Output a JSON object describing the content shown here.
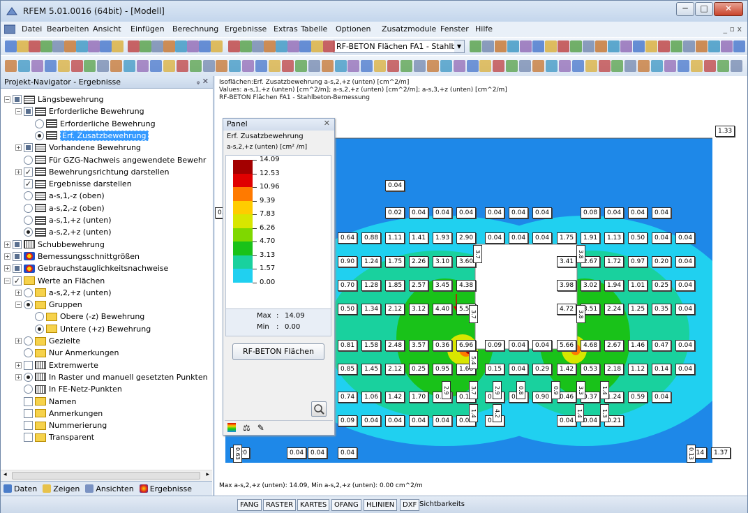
{
  "window": {
    "title": "RFEM 5.01.0016 (64bit) - [Modell]",
    "minimize": "─",
    "maximize": "□",
    "close": "✕"
  },
  "menu": [
    "Datei",
    "Bearbeiten",
    "Ansicht",
    "Einfügen",
    "Berechnung",
    "Ergebnisse",
    "Extras",
    "Tabelle",
    "Optionen",
    "Zusatzmodule",
    "Fenster",
    "Hilfe"
  ],
  "menu_sys": "_ ▫ x",
  "toolbar": {
    "combo_value": "RF-BETON Flächen FA1 - Stahlbeton-B"
  },
  "navigator": {
    "title": "Projekt-Navigator - Ergebnisse",
    "controls": "ᵩ ✕",
    "items": [
      "Längsbewehrung",
      "Erforderliche Bewehrung",
      "Erforderliche Bewehrung",
      "Erf. Zusatzbewehrung",
      "Vorhandene Bewehrung",
      "Für GZG-Nachweis angewendete Bewehr",
      "Bewehrungsrichtung darstellen",
      "Ergebnisse darstellen",
      "a-s,1,-z (oben)",
      "a-s,2,-z (oben)",
      "a-s,1,+z (unten)",
      "a-s,2,+z (unten)",
      "Schubbewehrung",
      "Bemessungsschnittgrößen",
      "Gebrauchstauglichkeitsnachweise",
      "Werte an Flächen",
      "a-s,2,+z (unten)",
      "Gruppen",
      "Obere (-z) Bewehrung",
      "Untere (+z) Bewehrung",
      "Gezielte",
      "Nur Anmerkungen",
      "Extremwerte",
      "In Raster und manuell gesetzten Punkten",
      "In FE-Netz-Punkten",
      "Namen",
      "Anmerkungen",
      "Nummerierung",
      "Transparent"
    ],
    "tabs": [
      "Daten",
      "Zeigen",
      "Ansichten",
      "Ergebnisse"
    ]
  },
  "view": {
    "info_lines": [
      "Isoflächen:Erf. Zusatzbewehrung a-s,2,+z (unten) [cm^2/m]",
      "Values: a-s,1,+z (unten) [cm^2/m]; a-s,2,+z (unten) [cm^2/m]; a-s,3,+z (unten) [cm^2/m]",
      "RF-BETON Flächen FA1 - Stahlbeton-Bemessung"
    ],
    "bottom_info": "Max a-s,2,+z (unten): 14.09, Min a-s,2,+z (unten): 0.00 cm^2/m",
    "grid_values": [
      [
        "0.04"
      ],
      [
        "0.02",
        "0.04",
        "0.04",
        "0.04",
        "0.04",
        "0.04",
        "0.04",
        "0.04",
        "0.08",
        "0.04",
        "0.04",
        "0.04"
      ],
      [
        "0.64",
        "0.88",
        "1.11",
        "1.41",
        "1.93",
        "2.90",
        "0.04",
        "0.04",
        "0.04",
        "1.75",
        "1.91",
        "1.13",
        "0.50",
        "0.04",
        "0.04"
      ],
      [
        "0.90",
        "1.24",
        "1.75",
        "2.26",
        "3.10",
        "3.60",
        "3.41",
        "2.67",
        "1.72",
        "0.97",
        "0.20",
        "0.04"
      ],
      [
        "0.70",
        "1.28",
        "1.85",
        "2.57",
        "3.45",
        "4.38",
        "3.98",
        "3.02",
        "1.94",
        "1.01",
        "0.25",
        "0.04"
      ],
      [
        "0.50",
        "1.34",
        "2.12",
        "3.12",
        "4.40",
        "5.55",
        "4.72",
        "3.51",
        "2.24",
        "1.25",
        "0.35",
        "0.04"
      ],
      [
        "0.81",
        "1.58",
        "2.48",
        "3.57",
        "0.36",
        "6.96",
        "0.09",
        "0.04",
        "0.04",
        "5.66",
        "4.68",
        "2.67",
        "1.46",
        "0.47",
        "0.04"
      ],
      [
        "0.85",
        "1.45",
        "2.12",
        "0.25",
        "0.95",
        "1.66",
        "0.15",
        "0.04",
        "0.29",
        "1.42",
        "0.53",
        "2.18",
        "1.12",
        "0.14",
        "0.04"
      ],
      [
        "0.74",
        "1.06",
        "1.42",
        "1.70",
        "0.24",
        "0.19",
        "0.49",
        "0.04",
        "0.90",
        "0.46",
        "0.37",
        "1.24",
        "0.59",
        "0.04"
      ],
      [
        "0.09",
        "0.04",
        "0.04",
        "0.04",
        "0.04",
        "0.04",
        "0.04",
        "0.04",
        "0.04",
        "0.21"
      ],
      [
        "0.20",
        "0.04",
        "0.04",
        "0.04",
        "0.14",
        "1.37"
      ]
    ],
    "corner_value": "1.33",
    "vertical_labels": [
      "3.7",
      "3.8",
      "5.4",
      "2.9",
      "3.7",
      "2.9",
      "0.8",
      "0.9",
      "3.3",
      "1.4",
      "1.4",
      "1.4",
      "1.3",
      "0.63",
      "0.13",
      "3.8",
      "3.7",
      "4.2"
    ]
  },
  "panel": {
    "title": "Panel",
    "close": "✕",
    "heading": "Erf. Zusatzbewehrung",
    "unit": "a-s,2,+z (unten) [cm² /m]",
    "legend_values": [
      "14.09",
      "12.53",
      "10.96",
      "9.39",
      "7.83",
      "6.26",
      "4.70",
      "3.13",
      "1.57",
      "0.00"
    ],
    "legend_colors": [
      "#a30000",
      "#e00000",
      "#ff7a00",
      "#ffcc00",
      "#d8e600",
      "#7fd800",
      "#19c219",
      "#19d19e",
      "#20d0f0",
      "#1e88e8"
    ],
    "max_label": "Max",
    "max_value": "14.09",
    "min_label": "Min",
    "min_value": "0.00",
    "button": "RF-BETON Flächen"
  },
  "statusbar": [
    "FANG",
    "RASTER",
    "KARTES",
    "OFANG",
    "HLINIEN",
    "DXF",
    "Sichtbarkeits"
  ]
}
